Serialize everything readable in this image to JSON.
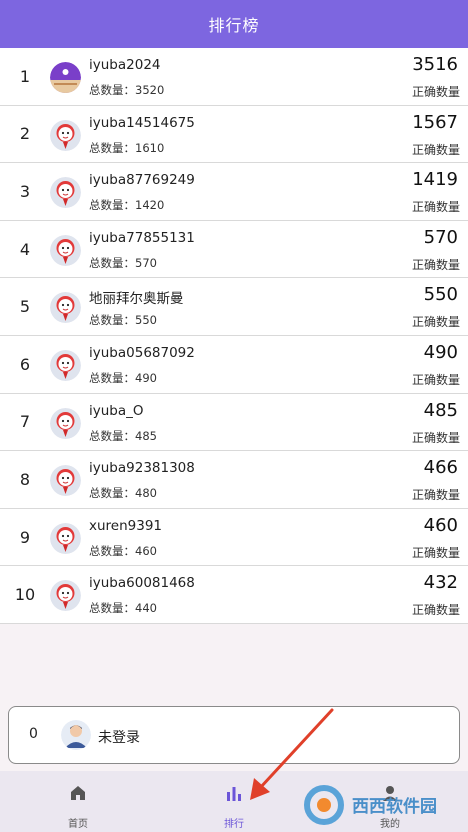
{
  "header": {
    "title": "排行榜"
  },
  "ranking": {
    "total_prefix": "总数量：",
    "score_label": "正确数量",
    "rows": [
      {
        "rank": "1",
        "name": "iyuba2024",
        "total": "3520",
        "score": "3516",
        "avatar": "photo-avatar"
      },
      {
        "rank": "2",
        "name": "iyuba14514675",
        "total": "1610",
        "score": "1567",
        "avatar": "default-avatar"
      },
      {
        "rank": "3",
        "name": "iyuba87769249",
        "total": "1420",
        "score": "1419",
        "avatar": "default-avatar"
      },
      {
        "rank": "4",
        "name": "iyuba77855131",
        "total": "570",
        "score": "570",
        "avatar": "default-avatar"
      },
      {
        "rank": "5",
        "name": "地丽拜尔奥斯曼",
        "total": "550",
        "score": "550",
        "avatar": "default-avatar"
      },
      {
        "rank": "6",
        "name": "iyuba05687092",
        "total": "490",
        "score": "490",
        "avatar": "default-avatar"
      },
      {
        "rank": "7",
        "name": "iyuba_O",
        "total": "485",
        "score": "485",
        "avatar": "default-avatar"
      },
      {
        "rank": "8",
        "name": "iyuba92381308",
        "total": "480",
        "score": "466",
        "avatar": "default-avatar"
      },
      {
        "rank": "9",
        "name": "xuren9391",
        "total": "460",
        "score": "460",
        "avatar": "default-avatar"
      },
      {
        "rank": "10",
        "name": "iyuba60081468",
        "total": "440",
        "score": "432",
        "avatar": "default-avatar"
      }
    ]
  },
  "my_rank": {
    "rank": "0",
    "name": "未登录",
    "avatar": "user-avatar-icon"
  },
  "tabs": [
    {
      "label": "首页",
      "icon": "home-icon",
      "active": false
    },
    {
      "label": "排行",
      "icon": "bar-chart-icon",
      "active": true
    },
    {
      "label": "我的",
      "icon": "person-icon",
      "active": false
    }
  ],
  "watermark": {
    "text": "西西软件园"
  },
  "colors": {
    "header_bg": "#7d66e0",
    "active_tab": "#6b55d8",
    "arrow": "#e0402a"
  }
}
